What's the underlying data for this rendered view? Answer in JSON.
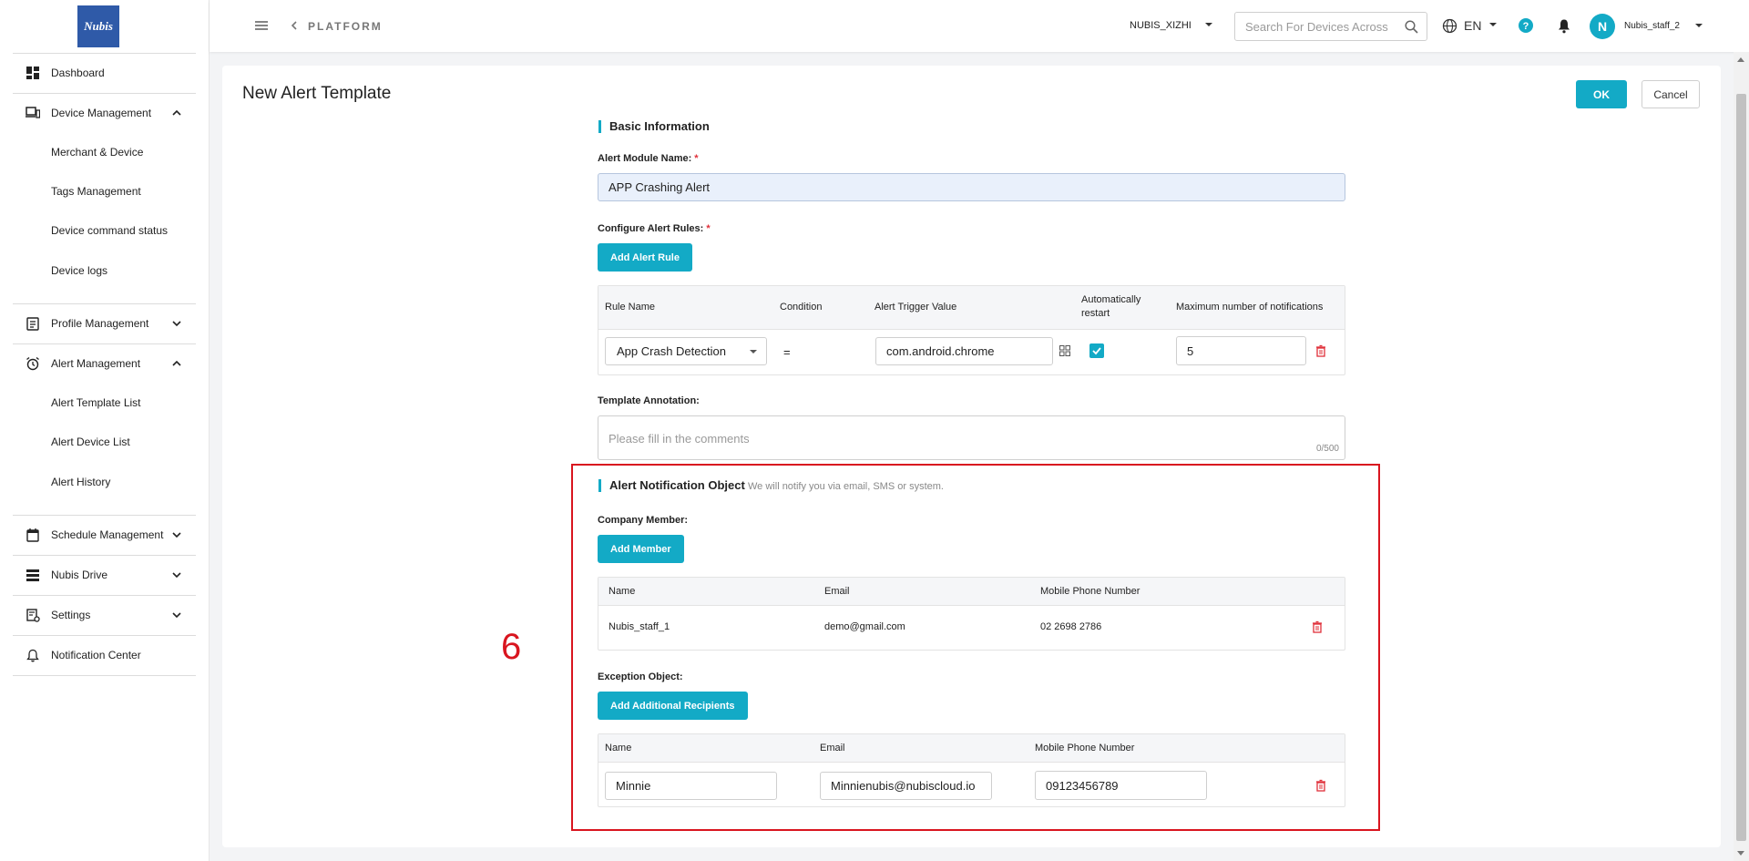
{
  "sidebar": {
    "logo": "Nubis",
    "items": [
      {
        "label": "Dashboard"
      },
      {
        "label": "Device Management",
        "subitems": [
          "Merchant & Device",
          "Tags Management",
          "Device command status",
          "Device logs"
        ]
      },
      {
        "label": "Profile Management"
      },
      {
        "label": "Alert Management",
        "subitems": [
          "Alert Template List",
          "Alert Device List",
          "Alert History"
        ]
      },
      {
        "label": "Schedule Management"
      },
      {
        "label": "Nubis Drive"
      },
      {
        "label": "Settings"
      },
      {
        "label": "Notification Center"
      }
    ]
  },
  "header": {
    "breadcrumb": "PLATFORM",
    "org": "NUBIS_XIZHI",
    "search_placeholder": "Search For Devices Across",
    "lang": "EN",
    "avatar_letter": "N",
    "username": "Nubis_staff_2"
  },
  "page": {
    "title": "New Alert Template",
    "ok_label": "OK",
    "cancel_label": "Cancel"
  },
  "basic": {
    "section_title": "Basic Information",
    "module_name_label": "Alert Module Name:",
    "module_name_value": "APP Crashing Alert",
    "rules_label": "Configure Alert Rules:",
    "add_rule_label": "Add Alert Rule",
    "rules_table": {
      "headers": [
        "Rule Name",
        "Condition",
        "Alert Trigger Value",
        "Automatically restart",
        "Maximum number of notifications"
      ],
      "row": {
        "rule_name": "App Crash Detection",
        "condition": "=",
        "trigger_value": "com.android.chrome",
        "auto_restart": true,
        "max_notifications": "5"
      }
    },
    "annotation_label": "Template Annotation:",
    "annotation_placeholder": "Please fill in the comments",
    "annotation_count": "0/500"
  },
  "notification": {
    "section_title": "Alert Notification Object",
    "section_subtitle": "We will notify you via email, SMS or system.",
    "company_label": "Company Member:",
    "add_member_label": "Add Member",
    "members_table": {
      "headers": [
        "Name",
        "Email",
        "Mobile Phone Number"
      ],
      "rows": [
        {
          "name": "Nubis_staff_1",
          "email": "demo@gmail.com",
          "phone": "02 2698 2786"
        }
      ]
    },
    "exception_label": "Exception Object:",
    "add_recipients_label": "Add Additional Recipients",
    "recipients_table": {
      "headers": [
        "Name",
        "Email",
        "Mobile Phone Number"
      ],
      "rows": [
        {
          "name": "Minnie",
          "email": "Minnienubis@nubiscloud.io",
          "phone": "09123456789"
        }
      ]
    }
  },
  "annotation_marker": {
    "number": "6",
    "color": "#d9151f"
  },
  "colors": {
    "accent": "#13aac6",
    "danger": "#e0303a",
    "brand": "#2f5aa8"
  }
}
